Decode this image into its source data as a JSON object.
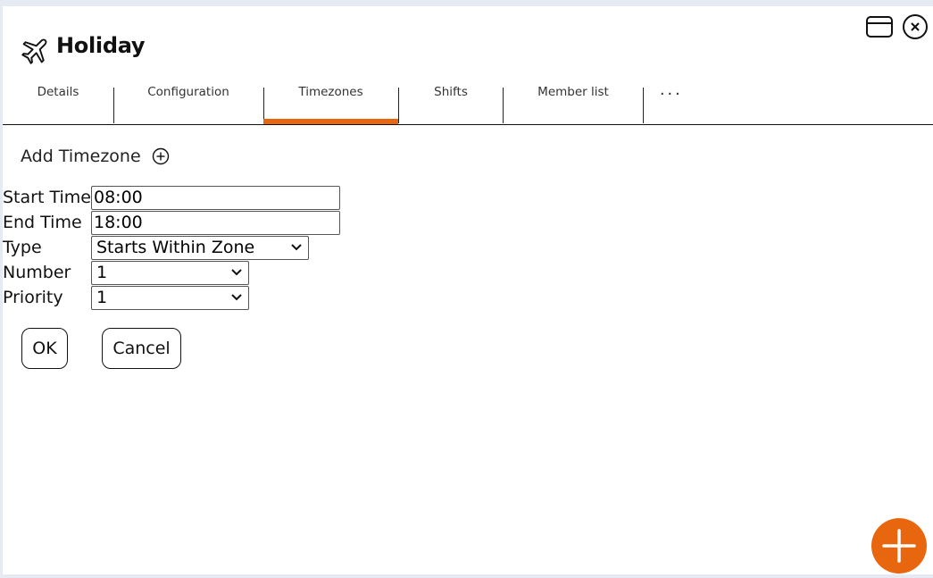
{
  "header": {
    "title": "Holiday",
    "icon": "airplane-icon"
  },
  "window_controls": {
    "maximize_icon": "window-maximize-icon",
    "close_icon": "close-circle-icon"
  },
  "tabs": [
    {
      "label": "Details",
      "active": false
    },
    {
      "label": "Configuration",
      "active": false
    },
    {
      "label": "Timezones",
      "active": true
    },
    {
      "label": "Shifts",
      "active": false
    },
    {
      "label": "Member list",
      "active": false
    }
  ],
  "more_label": "...",
  "add_timezone": {
    "label": "Add Timezone",
    "icon": "plus-circle-icon"
  },
  "form": {
    "start_time": {
      "label": "Start Time",
      "value": "08:00"
    },
    "end_time": {
      "label": "End Time",
      "value": "18:00"
    },
    "type": {
      "label": "Type",
      "value": "Starts Within Zone"
    },
    "number": {
      "label": "Number",
      "value": "1"
    },
    "priority": {
      "label": "Priority",
      "value": "1"
    }
  },
  "buttons": {
    "ok": "OK",
    "cancel": "Cancel"
  },
  "fab_icon": "plus-icon",
  "colors": {
    "accent": "#e8670e",
    "background": "#e6ebf3",
    "panel": "#ffffff"
  }
}
